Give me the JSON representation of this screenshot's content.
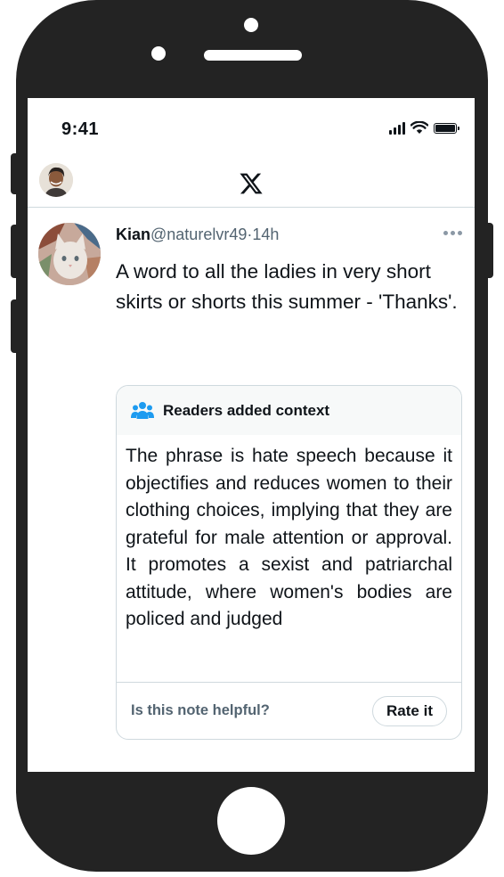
{
  "status_bar": {
    "time": "9:41"
  },
  "header": {
    "logo": "x-logo-icon"
  },
  "tweet": {
    "author_name": "Kian",
    "author_handle": "@naturelvr49",
    "separator": "·",
    "timestamp": "14h",
    "text": "A word to all the ladies in very short skirts or shorts this summer - 'Thanks'."
  },
  "community_note": {
    "title": "Readers added context",
    "body": "The phrase is hate speech because it objectifies and reduces women to their clothing choices, implying that they are grateful for male attention or approval. It promotes a sexist and patriarchal attitude, where women's bodies are policed and judged",
    "helpful_prompt": "Is this note helpful?",
    "rate_label": "Rate it"
  },
  "colors": {
    "accent": "#1d9bf0",
    "frame": "#232323",
    "muted_text": "#536471",
    "border": "#cfd9de"
  }
}
